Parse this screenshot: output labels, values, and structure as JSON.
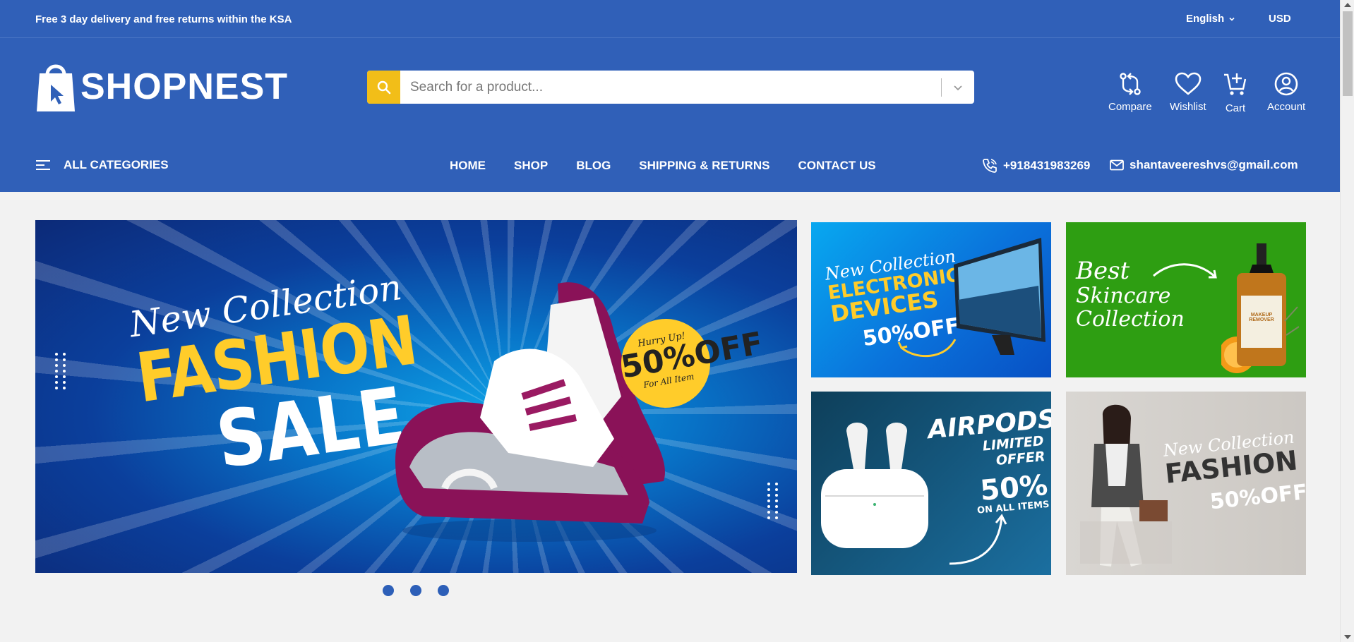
{
  "topbar": {
    "promo_text": "Free 3 day delivery and free returns within the KSA",
    "language": "English",
    "currency": "USD"
  },
  "header": {
    "logo_text": "SHOPNEST",
    "search": {
      "placeholder": "Search for a product..."
    },
    "actions": [
      {
        "label": "Compare",
        "icon": "compare-icon"
      },
      {
        "label": "Wishlist",
        "icon": "heart-icon"
      },
      {
        "label": "Cart",
        "icon": "cart-icon"
      },
      {
        "label": "Account",
        "icon": "user-icon"
      }
    ]
  },
  "nav": {
    "all_categories": "ALL CATEGORIES",
    "links": [
      "HOME",
      "SHOP",
      "BLOG",
      "SHIPPING & RETURNS",
      "CONTACT US"
    ],
    "phone": "+918431983269",
    "email": "shantaveereshvs@gmail.com"
  },
  "hero": {
    "script": "New Collection",
    "line1": "FASHION",
    "line2": "SALE",
    "tag": {
      "top": "Hurry Up!",
      "value": "50%OFF",
      "bottom": "For All Item"
    },
    "slide_count": 3,
    "active_slide": 1
  },
  "promos": [
    {
      "script": "New Collection",
      "title1": "ELECTRONIC",
      "title2": "DEVICES",
      "badge": "50%OFF"
    },
    {
      "line1": "Best",
      "line2": "Skincare",
      "line3": "Collection",
      "product": "MAKEUP REMOVER"
    },
    {
      "title": "AIRPODS",
      "sub": "LIMITED OFFER",
      "pct": "50%",
      "note": "ON ALL ITEMS"
    },
    {
      "script": "New Collection",
      "title": "FASHION",
      "pct": "50%OFF"
    }
  ],
  "colors": {
    "brand_blue": "#3060b8",
    "search_button": "#f2be18",
    "accent_yellow": "#ffcc2a",
    "page_bg": "#f2f2f2"
  }
}
